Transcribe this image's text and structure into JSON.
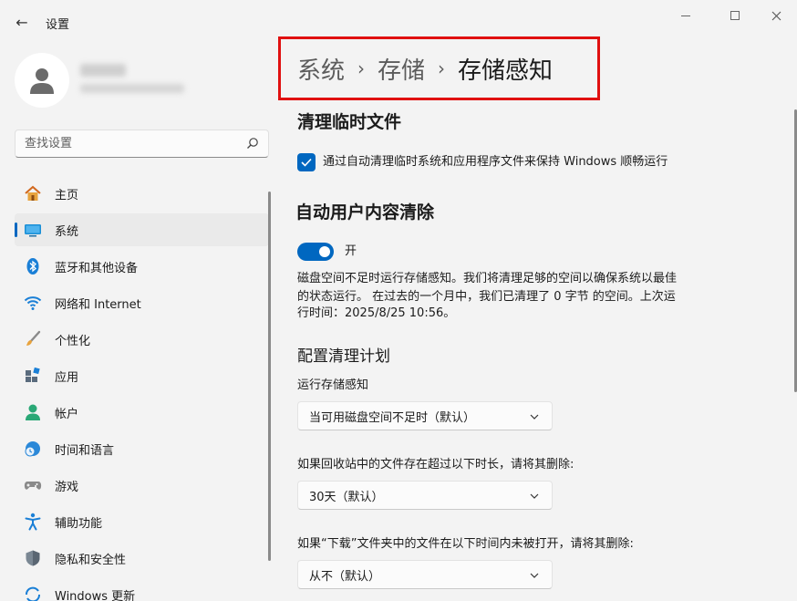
{
  "window": {
    "title": "设置",
    "back_icon": "←"
  },
  "search": {
    "placeholder": "查找设置"
  },
  "sidebar": {
    "items": [
      {
        "label": "主页",
        "icon": "home-icon"
      },
      {
        "label": "系统",
        "icon": "system-icon",
        "selected": true
      },
      {
        "label": "蓝牙和其他设备",
        "icon": "bluetooth-icon"
      },
      {
        "label": "网络和 Internet",
        "icon": "wifi-icon"
      },
      {
        "label": "个性化",
        "icon": "brush-icon"
      },
      {
        "label": "应用",
        "icon": "apps-icon"
      },
      {
        "label": "帐户",
        "icon": "account-icon"
      },
      {
        "label": "时间和语言",
        "icon": "clock-globe-icon"
      },
      {
        "label": "游戏",
        "icon": "gamepad-icon"
      },
      {
        "label": "辅助功能",
        "icon": "accessibility-icon"
      },
      {
        "label": "隐私和安全性",
        "icon": "shield-icon"
      },
      {
        "label": "Windows 更新",
        "icon": "update-icon"
      }
    ]
  },
  "breadcrumb": {
    "items": [
      "系统",
      "存储"
    ],
    "separator": "›",
    "current": "存储感知"
  },
  "main": {
    "cleanup_title": "清理临时文件",
    "cleanup_checkbox_label": "通过自动清理临时系统和应用程序文件来保持 Windows 顺畅运行",
    "auto_title": "自动用户内容清除",
    "toggle_label": "开",
    "description_line1": "磁盘空间不足时运行存储感知。我们将清理足够的空间以确保系统以最佳",
    "description_line2": "的状态运行。 在过去的一个月中，我们已清理了 0 字节 的空间。上次运",
    "description_line3": "行时间：2025/8/25 10:56。",
    "schedule_title": "配置清理计划",
    "run_label": "运行存储感知",
    "run_value": "当可用磁盘空间不足时（默认）",
    "recycle_label": "如果回收站中的文件存在超过以下时长，请将其删除:",
    "recycle_value": "30天（默认）",
    "downloads_label": "如果“下载”文件夹中的文件在以下时间内未被打开，请将其删除:",
    "downloads_value": "从不（默认）"
  },
  "colors": {
    "accent": "#0067c0",
    "highlight_border": "#e01010"
  }
}
